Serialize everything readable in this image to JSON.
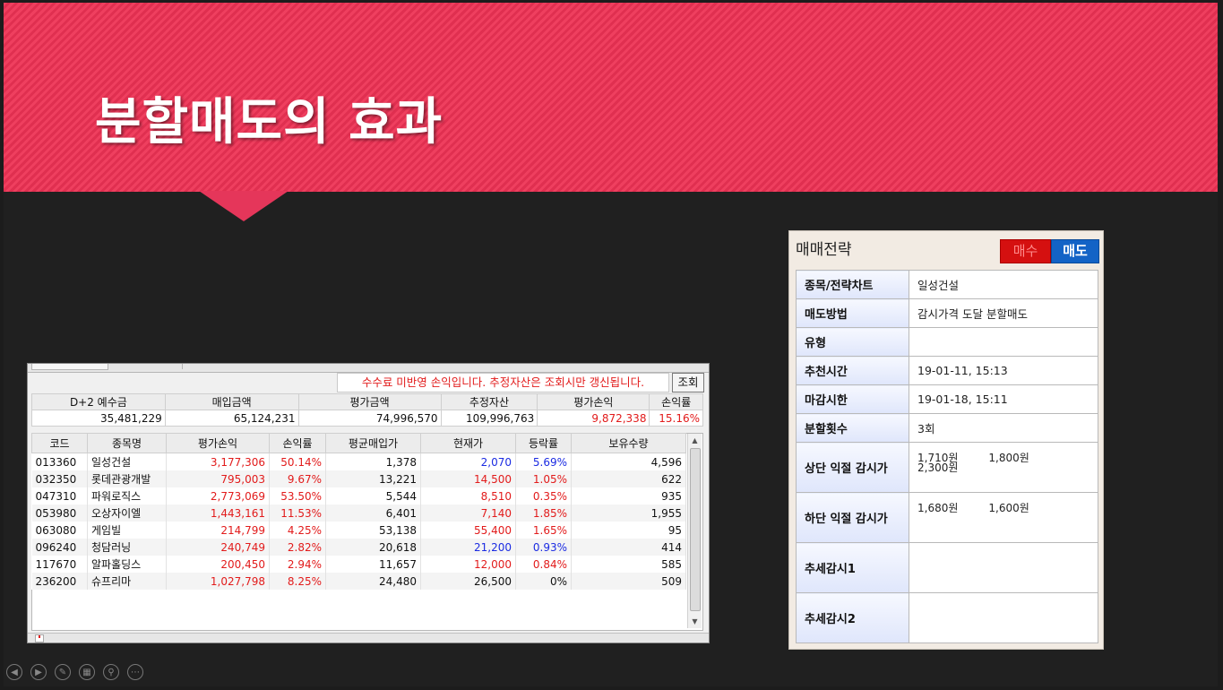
{
  "slide": {
    "title": "분할매도의 효과"
  },
  "account": {
    "notice": "수수료 미반영 손익입니다. 추정자산은 조회시만 갱신됩니다.",
    "query_label": "조회",
    "summary_headers": [
      "D+2 예수금",
      "매입금액",
      "평가금액",
      "추정자산",
      "평가손익",
      "손익률"
    ],
    "summary_values": [
      "35,481,229",
      "65,124,231",
      "74,996,570",
      "109,996,763",
      "9,872,338",
      "15.16%"
    ]
  },
  "holdings": {
    "headers": [
      "코드",
      "종목명",
      "평가손익",
      "손익률",
      "평균매입가",
      "현재가",
      "등락률",
      "보유수량"
    ],
    "rows": [
      [
        "013360",
        "일성건설",
        "3,177,306",
        "50.14%",
        "1,378",
        "2,070",
        "5.69%",
        "4,596"
      ],
      [
        "032350",
        "롯데관광개발",
        "795,003",
        "9.67%",
        "13,221",
        "14,500",
        "1.05%",
        "622"
      ],
      [
        "047310",
        "파워로직스",
        "2,773,069",
        "53.50%",
        "5,544",
        "8,510",
        "0.35%",
        "935"
      ],
      [
        "053980",
        "오상자이엘",
        "1,443,161",
        "11.53%",
        "6,401",
        "7,140",
        "1.85%",
        "1,955"
      ],
      [
        "063080",
        "게임빌",
        "214,799",
        "4.25%",
        "53,138",
        "55,400",
        "1.65%",
        "95"
      ],
      [
        "096240",
        "청담러닝",
        "240,749",
        "2.82%",
        "20,618",
        "21,200",
        "0.93%",
        "414"
      ],
      [
        "117670",
        "알파홀딩스",
        "200,450",
        "2.94%",
        "11,657",
        "12,000",
        "0.84%",
        "585"
      ],
      [
        "236200",
        "슈프리마",
        "1,027,798",
        "8.25%",
        "24,480",
        "26,500",
        "0%",
        "509"
      ]
    ],
    "price_colors": [
      "blue",
      "red",
      "red",
      "red",
      "red",
      "blue",
      "red",
      "black"
    ],
    "rate_colors": [
      "blue",
      "red",
      "red",
      "red",
      "red",
      "blue",
      "red",
      "black"
    ]
  },
  "strategy": {
    "title": "매매전략",
    "buy_label": "매수",
    "sell_label": "매도",
    "rows": [
      {
        "key": "종목/전략차트",
        "value": "일성건설"
      },
      {
        "key": "매도방법",
        "value": "감시가격 도달 분할매도"
      },
      {
        "key": "유형",
        "value": ""
      },
      {
        "key": "추천시간",
        "value": "19-01-11, 15:13"
      },
      {
        "key": "마감시한",
        "value": "19-01-18, 15:11"
      },
      {
        "key": "분할횟수",
        "value": "3회"
      },
      {
        "key": "상단 익절 감시가",
        "value": "",
        "values": [
          "1,710원",
          "1,800원",
          "2,300원"
        ]
      },
      {
        "key": "하단 익절 감시가",
        "value": "",
        "values": [
          "1,680원",
          "1,600원"
        ]
      },
      {
        "key": "추세감시1",
        "value": ""
      },
      {
        "key": "추세감시2",
        "value": ""
      }
    ]
  },
  "controls": [
    "prev-icon",
    "next-icon",
    "pen-icon",
    "slides-icon",
    "zoom-icon",
    "more-icon"
  ],
  "colors": {
    "banner": "#e8385a",
    "buy": "#d51010",
    "sell": "#1363c6",
    "gain": "#e21b1b",
    "down": "#1b2be2"
  }
}
